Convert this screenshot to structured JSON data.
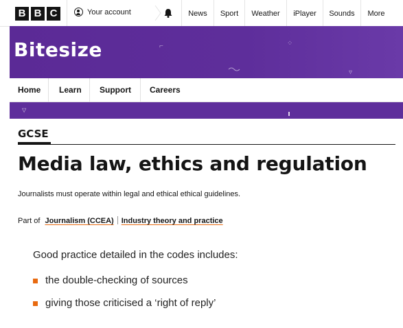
{
  "global_nav": {
    "logo_letters": [
      "B",
      "B",
      "C"
    ],
    "account_label": "Your account",
    "notifications_icon": "bell-icon",
    "links": [
      "News",
      "Sport",
      "Weather",
      "iPlayer",
      "Sounds",
      "More"
    ]
  },
  "banner": {
    "title": "Bitesize",
    "background_color": "#5e2e9b"
  },
  "section_nav": {
    "items": [
      "Home",
      "Learn",
      "Support",
      "Careers"
    ]
  },
  "page": {
    "level": "GCSE",
    "title": "Media law, ethics and regulation",
    "summary": "Journalists must operate within legal and ethical ethical guidelines.",
    "part_of_label": "Part of",
    "part_of_links": [
      "Journalism (CCEA)",
      "Industry theory and practice"
    ],
    "accent_color": "#e86a10"
  },
  "content": {
    "intro": "Good practice detailed in the codes includes:",
    "bullets": [
      "the double-checking of sources",
      "giving those criticised a ‘right of reply’"
    ]
  }
}
